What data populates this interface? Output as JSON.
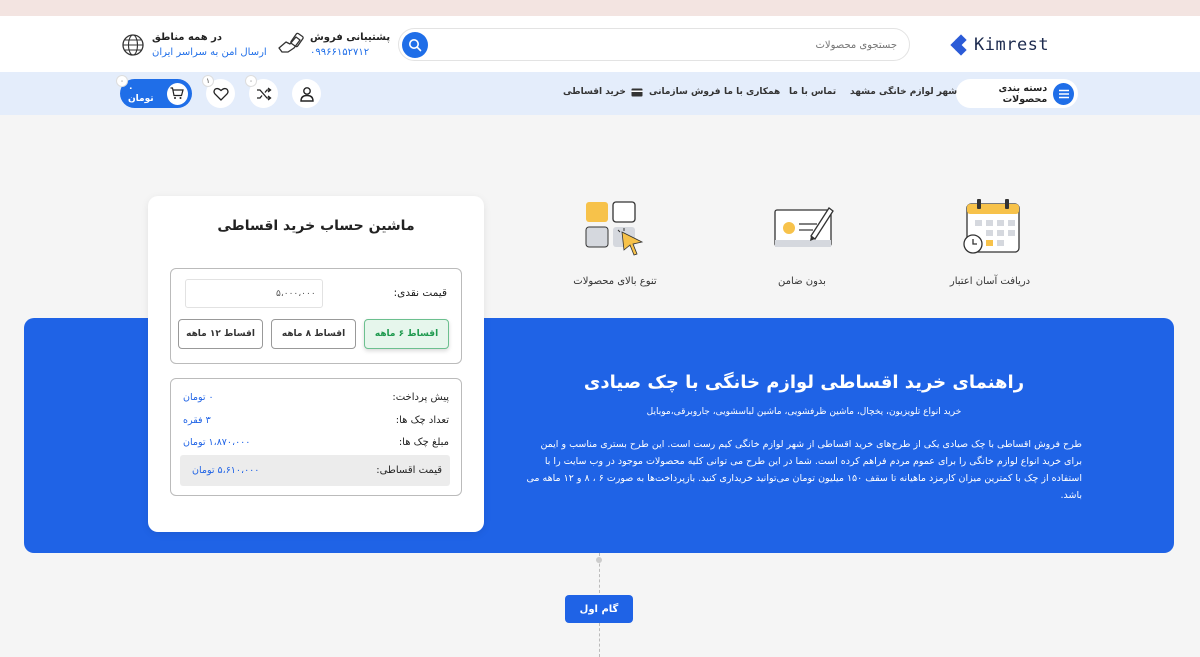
{
  "header": {
    "logo_text": "Kimrest",
    "search_placeholder": "جستجوی محصولات",
    "support": {
      "title": "پشتیبانی فروش",
      "phone": "۰۹۹۶۶۱۵۲۷۱۲"
    },
    "shipping": {
      "title": "در همه مناطق",
      "subtitle": "ارسال امن به سراسر ایران"
    }
  },
  "nav": {
    "categories_label": "دسته بندی محصولات",
    "items": [
      "شهر لوازم خانگی مشهد",
      "تماس با ما",
      "همکاری با ما",
      "فروش سازمانی",
      "خرید اقساطی"
    ],
    "badges": {
      "compare": "۰",
      "wishlist": "۱",
      "cart": "۰"
    },
    "cart_total": "۰ تومان"
  },
  "features": [
    {
      "label": "دریافت آسان اعتبار",
      "icon": "calendar-clock-icon"
    },
    {
      "label": "بدون ضامن",
      "icon": "cheque-pen-icon"
    },
    {
      "label": "تنوع بالای  محصولات",
      "icon": "grid-cursor-icon"
    }
  ],
  "banner": {
    "title": "راهنمای خرید اقساطی لوازم خانگی با چک صیادی",
    "subtitle": "خرید انواع تلویزیون، یخچال، ماشین ظرفشویی، ماشین لباسشویی، جاروبرقی،موبایل",
    "body": "طرح فروش اقساطی با چک صیادی یکی از طرح‌های خرید اقساطی از شهر لوازم خانگی کیم رست است. این طرح  بستری مناسب و ایمن برای خرید انواع لوازم خانگی را برای عموم مردم فراهم کرده است. شما در این طرح می توانی کلیه محصولات موجود در وب سایت را با استفاده از چک با کمترین میزان کارمزد ماهیانه تا سقف ۱۵۰ میلیون تومان می‌توانید خریداری کنید. بازپرداخت‌ها به صورت ۶ ، ۸ و ۱۲ ماهه می باشد."
  },
  "calculator": {
    "title": "ماشین حساب خرید اقساطی",
    "cash_label": "قیمت نقدی:",
    "cash_value": "۵،۰۰۰،۰۰۰",
    "tabs": [
      "اقساط ۶ ماهه",
      "اقساط ۸ ماهه",
      "اقساط ۱۲ ماهه"
    ],
    "active_tab": "اقساط ۶ ماهه",
    "rows": [
      {
        "label": "پیش پرداخت:",
        "value": "۰ تومان"
      },
      {
        "label": "تعداد چک ها:",
        "value": "۳ فقره"
      },
      {
        "label": "مبلغ چک ها:",
        "value": "۱،۸۷۰،۰۰۰ تومان"
      }
    ],
    "total": {
      "label": "قیمت اقساطی:",
      "value": "۵،۶۱۰،۰۰۰ تومان"
    }
  },
  "step": {
    "label": "گام اول"
  },
  "colors": {
    "primary": "#1f63e6",
    "nav_bg": "#e4edfb",
    "topbar": "#f3e4e1",
    "active_tab": "#1f9a4f"
  }
}
